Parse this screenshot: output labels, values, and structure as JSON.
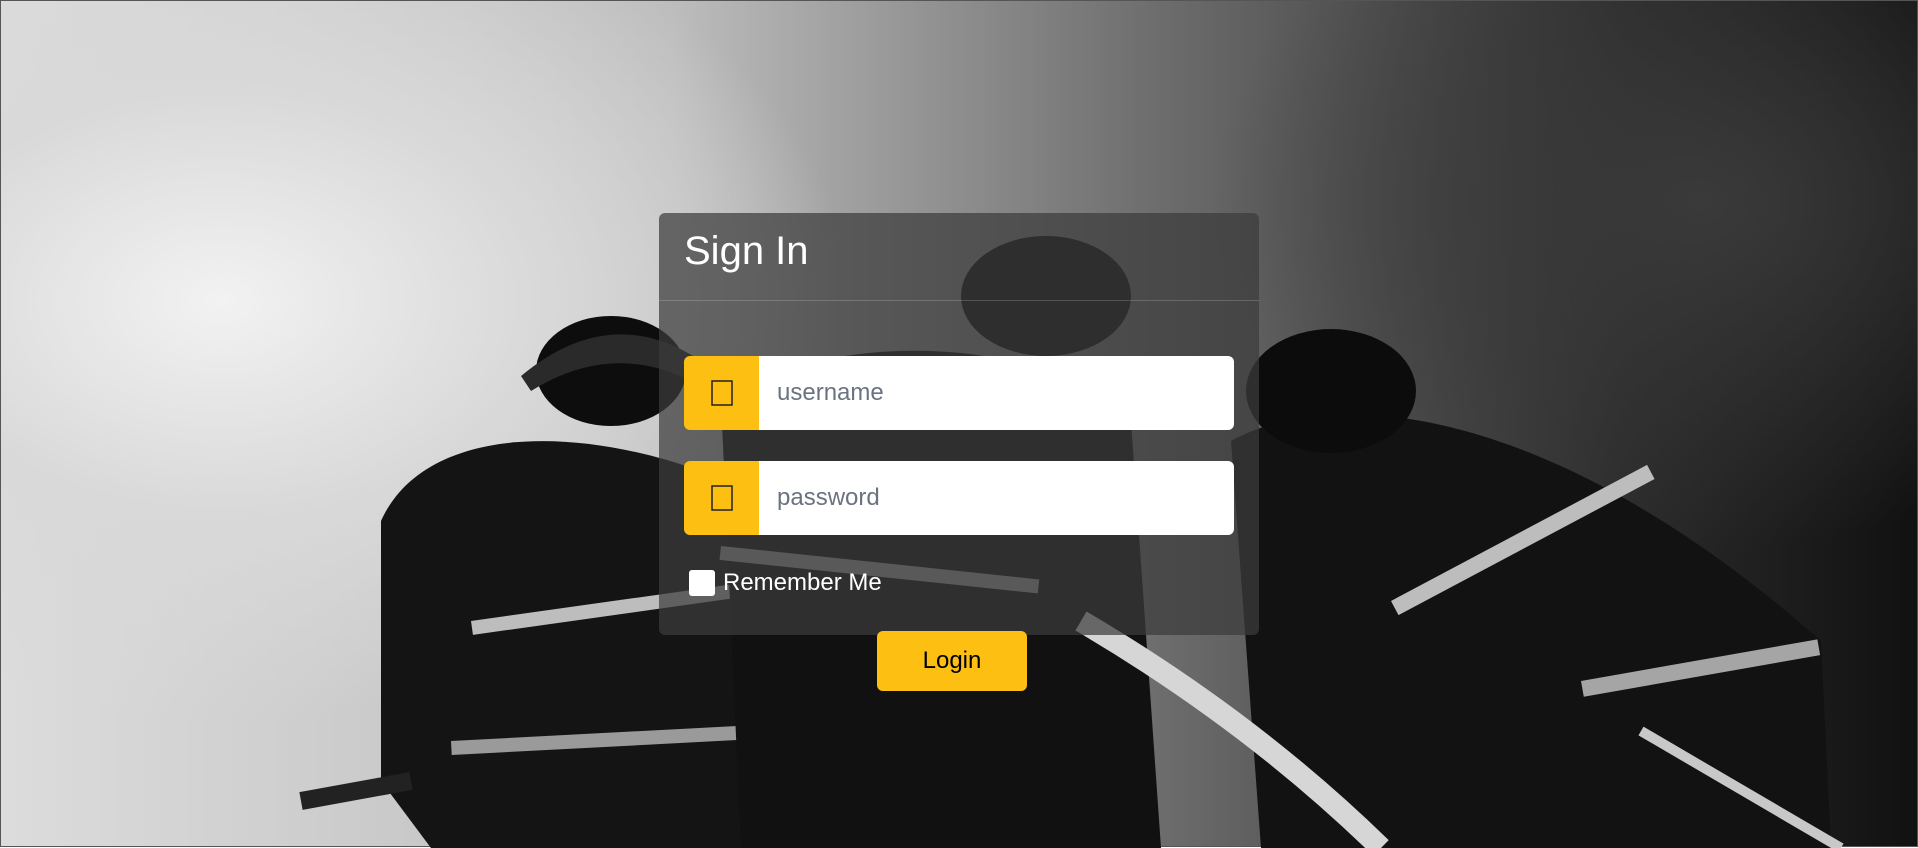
{
  "login": {
    "title": "Sign In",
    "username_placeholder": "username",
    "password_placeholder": "password",
    "remember_label": "Remember Me",
    "login_label": "Login"
  },
  "theme": {
    "accent": "#fdbf12",
    "panel": "rgba(60,60,60,0.72)"
  },
  "icons": {
    "username": "user-icon",
    "password": "lock-icon"
  }
}
